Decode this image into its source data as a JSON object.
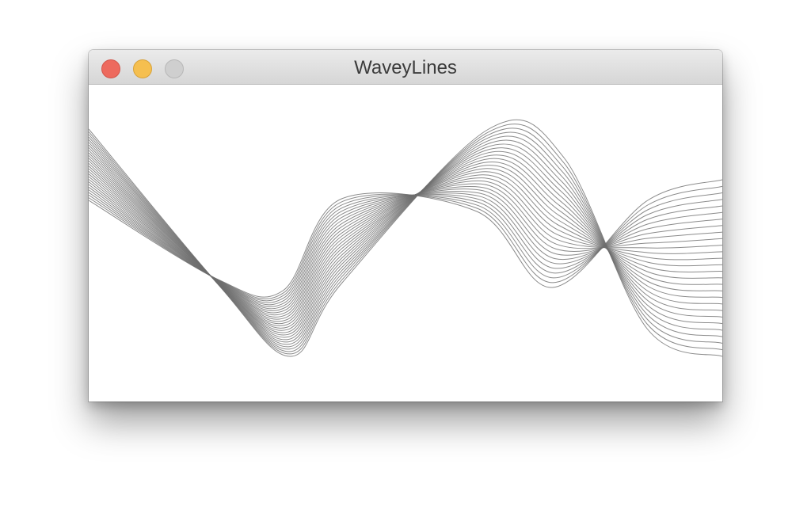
{
  "window": {
    "title": "WaveyLines"
  },
  "icons": {
    "close": "close-icon",
    "minimize": "minimize-icon",
    "zoom": "zoom-icon"
  },
  "colors": {
    "close": "#ed6a5e",
    "minimize": "#f5bf4f",
    "zoom_disabled": "#cfcfcf",
    "line": "#6e6e6e",
    "canvas_background": "#ffffff"
  }
}
